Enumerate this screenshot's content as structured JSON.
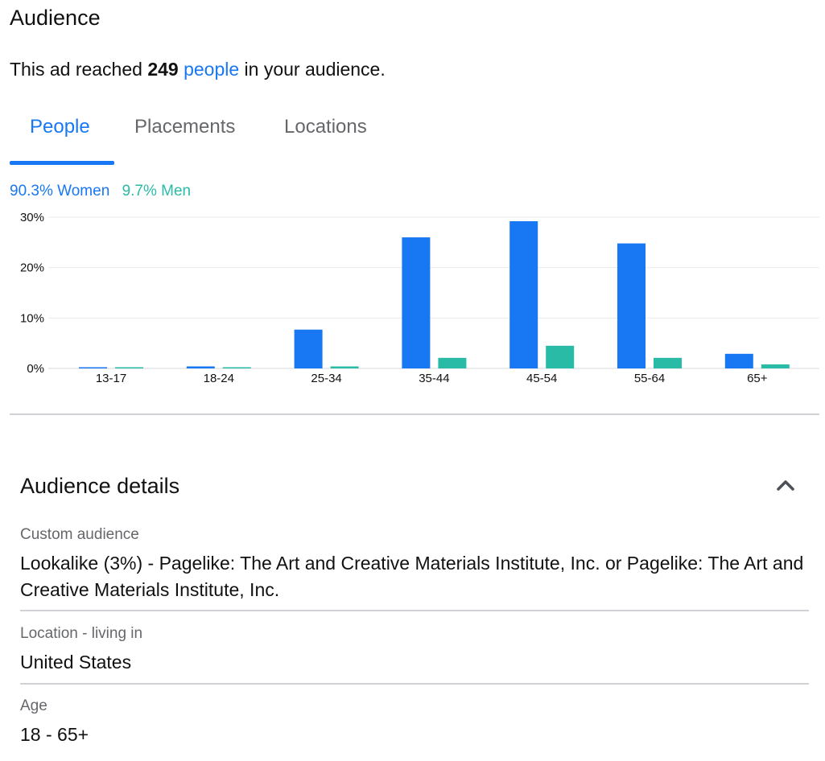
{
  "header": {
    "title": "Audience"
  },
  "reach": {
    "prefix": "This ad reached ",
    "count": "249",
    "link": "people",
    "suffix": " in your audience."
  },
  "tabs": [
    {
      "label": "People",
      "active": true
    },
    {
      "label": "Placements",
      "active": false
    },
    {
      "label": "Locations",
      "active": false
    }
  ],
  "legend": {
    "women": "90.3% Women",
    "men": "9.7% Men"
  },
  "colors": {
    "accent": "#1877f2",
    "women": "#1877f2",
    "men": "#2abba7"
  },
  "chart_data": {
    "type": "bar",
    "categories": [
      "13-17",
      "18-24",
      "25-34",
      "35-44",
      "45-54",
      "55-64",
      "65+"
    ],
    "series": [
      {
        "name": "Women",
        "values": [
          0.2,
          0.4,
          7.7,
          26.0,
          29.2,
          24.8,
          2.9
        ]
      },
      {
        "name": "Men",
        "values": [
          0.2,
          0.2,
          0.4,
          2.1,
          4.5,
          2.1,
          0.8
        ]
      }
    ],
    "yticks": [
      "0%",
      "10%",
      "20%",
      "30%"
    ],
    "ylim": [
      0,
      30
    ],
    "grid": true
  },
  "details": {
    "title": "Audience details",
    "collapse_icon": "chevron-up-icon",
    "items": [
      {
        "label": "Custom audience",
        "value": "Lookalike (3%) - Pagelike: The Art and Creative Materials Institute, Inc. or Pagelike: The Art and Creative Materials Institute, Inc."
      },
      {
        "label": "Location - living in",
        "value": "United States"
      },
      {
        "label": "Age",
        "value": "18 - 65+"
      }
    ]
  }
}
